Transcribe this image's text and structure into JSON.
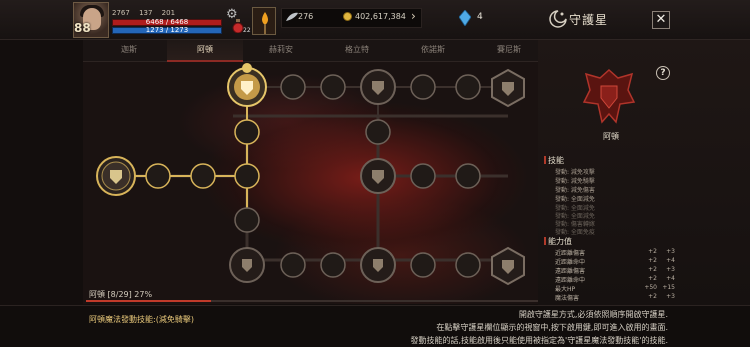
{
  "player": {
    "level": "88",
    "stat_a": "2767",
    "stat_b": "137",
    "stat_c": "201",
    "hp": "6468 / 6468",
    "mp": "1273 / 1273",
    "potion_count": "22"
  },
  "resources": {
    "feather": "276",
    "gold": "402,617,384",
    "crystal": "4"
  },
  "window": {
    "title": "守護星",
    "close": "✕",
    "help": "?"
  },
  "tabs": [
    "迦斯",
    "阿頓",
    "赫莉安",
    "格立特",
    "依諾斯",
    "賽尼斯"
  ],
  "active_tab": 1,
  "progress": {
    "label": "阿頓 [8/29] 27%",
    "fraction": 0.2759
  },
  "panel": {
    "name": "阿頓",
    "skills_header": "技能",
    "skills": [
      {
        "text": "發動: 減免攻擊",
        "active": true
      },
      {
        "text": "發動: 減免騎擊",
        "active": true
      },
      {
        "text": "發動: 減免傷害",
        "active": true
      },
      {
        "text": "發動: 全面減免",
        "active": true
      },
      {
        "text": "發動: 全面減免",
        "active": false
      },
      {
        "text": "發動: 全面減免",
        "active": false
      },
      {
        "text": "發動: 傷害轉嫁",
        "active": false
      },
      {
        "text": "發動: 全面免疫",
        "active": false
      }
    ],
    "stats_header": "能力值",
    "stats": [
      {
        "name": "近距離傷害",
        "a": "+2",
        "b": "+3"
      },
      {
        "name": "近距離命中",
        "a": "+2",
        "b": "+4"
      },
      {
        "name": "遠距離傷害",
        "a": "+2",
        "b": "+3"
      },
      {
        "name": "遠距離命中",
        "a": "+2",
        "b": "+4"
      },
      {
        "name": "最大HP",
        "a": "+50",
        "b": "+15"
      },
      {
        "name": "魔法傷害",
        "a": "+2",
        "b": "+3"
      }
    ]
  },
  "footer": {
    "left": "阿頓魔法發動技能:(減免騎擊)",
    "lines": [
      "開啟守護星方式,必須依照順序開啟守護星.",
      "在點擊守護星欄位顯示的視窗中,按下啟用鍵,即可進入啟用的畫面.",
      "發動技能的話,技能啟用後只能使用被指定為'守護星魔法發動技能'的技能."
    ]
  },
  "colors": {
    "accent": "#b03a2a",
    "hp": "#b01d1d",
    "mp": "#2466b8",
    "gold": "#e0b640",
    "node_active": "#d8b45a"
  }
}
